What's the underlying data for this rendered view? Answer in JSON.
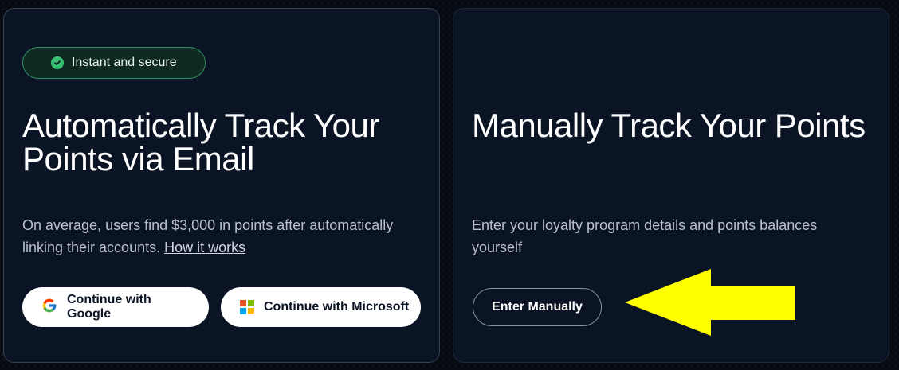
{
  "left_card": {
    "badge": "Instant and secure",
    "title": "Automatically Track Your Points via Email",
    "description": "On average, users find $3,000 in points after automatically linking their accounts.",
    "link": "How it works",
    "buttons": {
      "google": "Continue with Google",
      "microsoft": "Continue with Microsoft"
    }
  },
  "right_card": {
    "title": "Manually Track Your Points",
    "description": "Enter your loyalty program details and points balances yourself",
    "button": "Enter Manually"
  },
  "annotation": {
    "arrow_color": "#ffff00",
    "arrow_icon": "yellow-arrow-left"
  },
  "colors": {
    "background": "#070b14",
    "card": "#0b1424",
    "badge_border": "#2f8f62",
    "badge_check": "#38c172"
  }
}
